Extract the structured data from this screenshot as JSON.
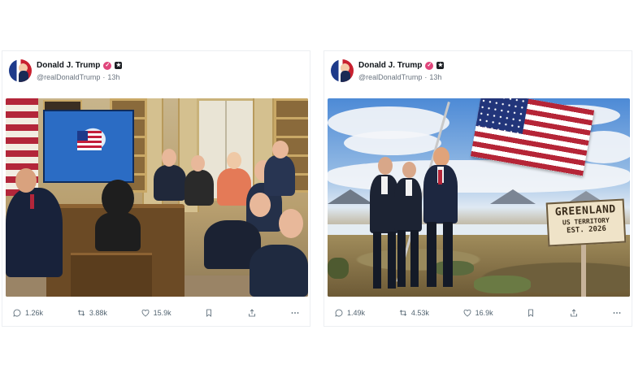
{
  "posts": [
    {
      "author": {
        "display_name": "Donald J. Trump",
        "handle": "@realDonaldTrump",
        "time": "13h"
      },
      "separator": "·",
      "media": {
        "type": "photo",
        "subject": "oval-office-greenland-meeting"
      },
      "metrics": {
        "replies": "1.26k",
        "reposts": "3.88k",
        "likes": "15.9k"
      }
    },
    {
      "author": {
        "display_name": "Donald J. Trump",
        "handle": "@realDonaldTrump",
        "time": "13h"
      },
      "separator": "·",
      "media": {
        "type": "photo",
        "subject": "flag-planting-greenland",
        "sign": {
          "line1": "GREENLAND",
          "line2": "US TERRITORY",
          "line3": "EST. 2026"
        }
      },
      "metrics": {
        "replies": "1.49k",
        "reposts": "4.53k",
        "likes": "16.9k"
      }
    }
  ],
  "icons": {
    "verified": "verified-badge-icon",
    "affiliation": "affiliation-badge-icon",
    "reply": "reply-icon",
    "repost": "repost-icon",
    "like": "heart-icon",
    "bookmark": "bookmark-icon",
    "share": "share-icon",
    "more": "more-icon"
  },
  "colors": {
    "verified_badge": "#e0457b",
    "text_primary": "#0f1419",
    "text_secondary": "#536471"
  }
}
